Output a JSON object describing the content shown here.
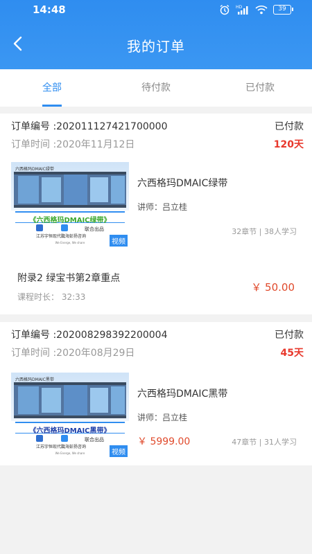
{
  "status_bar": {
    "time": "14:48",
    "battery": "39",
    "network": "HD"
  },
  "header": {
    "title": "我的订单"
  },
  "tabs": [
    {
      "label": "全部",
      "active": true
    },
    {
      "label": "待付款",
      "active": false
    },
    {
      "label": "已付款",
      "active": false
    }
  ],
  "colors": {
    "accent": "#2f8df0",
    "price": "#e04a2c",
    "days": "#e8382c"
  },
  "orders": [
    {
      "order_no": "订单编号 :202011127421700000",
      "status": "已付款",
      "time": "订单时间 :2020年11月12日",
      "days": "120天",
      "thumb": {
        "title": "六西格玛DMAIC绿带",
        "brand": "《六西格玛DMAIC绿带》",
        "brand_color": "#3aa82e",
        "logo1": "江苏宇恒现代院",
        "logo2": "上海彭扬咨询",
        "joint": "联合出品",
        "slogan": "We Energe, We share",
        "badge": "视频"
      },
      "course_name": "六西格玛DMAIC绿带",
      "lecturer": "讲师：吕立桂",
      "stats": "32章节 | 38人学习",
      "chapter": {
        "title": "附录2 绿宝书第2章重点",
        "duration": "课程时长： 32:33",
        "price": "￥ 50.00"
      }
    },
    {
      "order_no": "订单编号 :202008298392200004",
      "status": "已付款",
      "time": "订单时间 :2020年08月29日",
      "days": "45天",
      "thumb": {
        "title": "六西格玛DMAIC黑带",
        "brand": "《六西格玛DMAIC黑带》",
        "brand_color": "#1e3fa8",
        "logo1": "江苏宇恒现代院",
        "logo2": "上海彭扬咨询",
        "joint": "联合出品",
        "slogan": "We Energe, We share",
        "badge": "视频"
      },
      "course_name": "六西格玛DMAIC黑带",
      "lecturer": "讲师：吕立桂",
      "price": "￥ 5999.00",
      "stats": "47章节 | 31人学习"
    }
  ]
}
